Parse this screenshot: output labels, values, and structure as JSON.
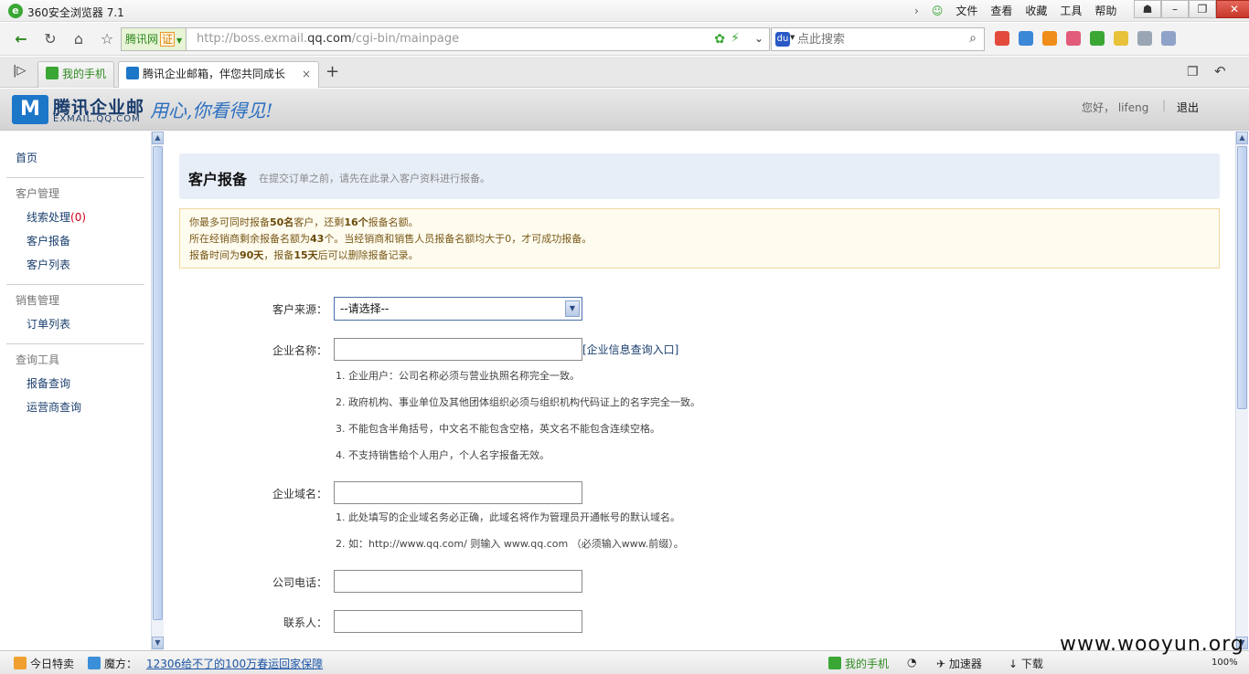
{
  "window": {
    "title": "360安全浏览器 7.1",
    "menus": [
      "文件",
      "查看",
      "收藏",
      "工具",
      "帮助"
    ]
  },
  "addressbar": {
    "cert_site": "腾讯网",
    "cert_badge": "证",
    "url_prefix": "http://boss.exmail.",
    "url_domain": "qq.com",
    "url_suffix": "/cgi-bin/mainpage",
    "search_placeholder": "点此搜索"
  },
  "tabs": [
    {
      "label": "我的手机",
      "active": false
    },
    {
      "label": "腾讯企业邮箱，伴您共同成长",
      "active": true
    }
  ],
  "header": {
    "brand": "腾讯企业邮",
    "brand_sub": "EXMAIL.QQ.COM",
    "slogan": "用心,你看得见!",
    "greeting": "您好， lifeng",
    "separator": "|",
    "logout": "退出"
  },
  "sidebar": {
    "home": "首页",
    "groups": [
      {
        "title": "客户管理",
        "items": [
          {
            "label": "线索处理",
            "count": "(0)"
          },
          {
            "label": "客户报备"
          },
          {
            "label": "客户列表"
          }
        ]
      },
      {
        "title": "销售管理",
        "items": [
          {
            "label": "订单列表"
          }
        ]
      },
      {
        "title": "查询工具",
        "items": [
          {
            "label": "报备查询"
          },
          {
            "label": "运营商查询"
          }
        ]
      }
    ]
  },
  "banner": {
    "title": "客户报备",
    "subtitle": "在提交订单之前，请先在此录入客户资料进行报备。"
  },
  "notice": {
    "l1_a": "你最多可同时报备",
    "l1_b": "50名",
    "l1_c": "客户，还剩",
    "l1_d": "16个",
    "l1_e": "报备名额。",
    "l2_a": "所在经销商剩余报备名额为",
    "l2_b": "43",
    "l2_c": "个。当经销商和销售人员报备名额均大于0，才可成功报备。",
    "l3_a": "报备时间为",
    "l3_b": "90天",
    "l3_c": "，报备",
    "l3_d": "15天",
    "l3_e": "后可以删除报备记录。"
  },
  "form": {
    "source_label": "客户来源：",
    "source_value": "--请选择--",
    "company_label": "企业名称：",
    "company_link": "[企业信息查询入口]",
    "company_hints": [
      "1. 企业用户：公司名称必须与营业执照名称完全一致。",
      "2. 政府机构、事业单位及其他团体组织必须与组织机构代码证上的名字完全一致。",
      "3. 不能包含半角括号，中文名不能包含空格，英文名不能包含连续空格。",
      "4. 不支持销售给个人用户，个人名字报备无效。"
    ],
    "domain_label": "企业域名：",
    "domain_hints": [
      "1. 此处填写的企业域名务必正确，此域名将作为管理员开通帐号的默认域名。",
      "2. 如：http://www.qq.com/ 则输入 www.qq.com （必须输入www.前缀）。"
    ],
    "phone_label": "公司电话：",
    "contact_label": "联系人："
  },
  "statusbar": {
    "deals": "今日特卖",
    "magic": "魔方：",
    "news": "12306给不了的100万春运回家保障",
    "phone": "我的手机",
    "accelerator": "加速器",
    "download": "下载",
    "zoom": "100%"
  },
  "watermark": "www.wooyun.org"
}
